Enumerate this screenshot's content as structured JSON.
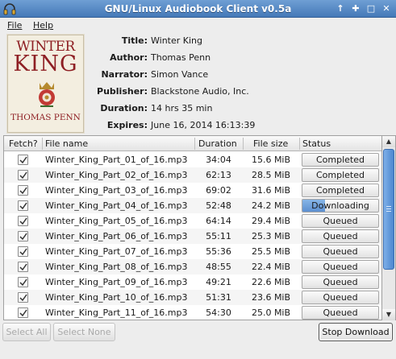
{
  "window": {
    "title": "GNU/Linux Audiobook Client v0.5a",
    "btn_up": "↑",
    "btn_more": "✚",
    "btn_max": "□",
    "btn_close": "✕"
  },
  "menu": {
    "file": "File",
    "help": "Help"
  },
  "cover": {
    "line1": "WINTER",
    "line2": "KING",
    "line3": "THOMAS PENN"
  },
  "info": {
    "title_label": "Title:",
    "title": "Winter King",
    "author_label": "Author:",
    "author": "Thomas Penn",
    "narrator_label": "Narrator:",
    "narrator": "Simon Vance",
    "publisher_label": "Publisher:",
    "publisher": "Blackstone Audio, Inc.",
    "duration_label": "Duration:",
    "duration": "14 hrs 35 min",
    "expires_label": "Expires:",
    "expires": "June 16, 2014 16:13:39"
  },
  "table": {
    "columns": {
      "fetch": "Fetch?",
      "file": "File name",
      "duration": "Duration",
      "size": "File size",
      "status": "Status"
    },
    "rows": [
      {
        "file": "Winter_King_Part_01_of_16.mp3",
        "duration": "34:04",
        "size": "15.6 MiB",
        "status": "Completed",
        "progress": 0
      },
      {
        "file": "Winter_King_Part_02_of_16.mp3",
        "duration": "62:13",
        "size": "28.5 MiB",
        "status": "Completed",
        "progress": 0
      },
      {
        "file": "Winter_King_Part_03_of_16.mp3",
        "duration": "69:02",
        "size": "31.6 MiB",
        "status": "Completed",
        "progress": 0
      },
      {
        "file": "Winter_King_Part_04_of_16.mp3",
        "duration": "52:48",
        "size": "24.2 MiB",
        "status": "Downloading",
        "progress": 0.3
      },
      {
        "file": "Winter_King_Part_05_of_16.mp3",
        "duration": "64:14",
        "size": "29.4 MiB",
        "status": "Queued",
        "progress": 0
      },
      {
        "file": "Winter_King_Part_06_of_16.mp3",
        "duration": "55:11",
        "size": "25.3 MiB",
        "status": "Queued",
        "progress": 0
      },
      {
        "file": "Winter_King_Part_07_of_16.mp3",
        "duration": "55:36",
        "size": "25.5 MiB",
        "status": "Queued",
        "progress": 0
      },
      {
        "file": "Winter_King_Part_08_of_16.mp3",
        "duration": "48:55",
        "size": "22.4 MiB",
        "status": "Queued",
        "progress": 0
      },
      {
        "file": "Winter_King_Part_09_of_16.mp3",
        "duration": "49:21",
        "size": "22.6 MiB",
        "status": "Queued",
        "progress": 0
      },
      {
        "file": "Winter_King_Part_10_of_16.mp3",
        "duration": "51:31",
        "size": "23.6 MiB",
        "status": "Queued",
        "progress": 0
      },
      {
        "file": "Winter_King_Part_11_of_16.mp3",
        "duration": "54:30",
        "size": "25.0 MiB",
        "status": "Queued",
        "progress": 0
      }
    ]
  },
  "buttons": {
    "select_all": "Select All",
    "select_none": "Select None",
    "stop": "Stop Download"
  },
  "colors": {
    "titlebar": "#4f82c0",
    "accent": "#5c8fd0",
    "cover_red": "#8e1f23"
  },
  "icons": {
    "app": "headphones-icon",
    "check": "checkmark-icon"
  }
}
